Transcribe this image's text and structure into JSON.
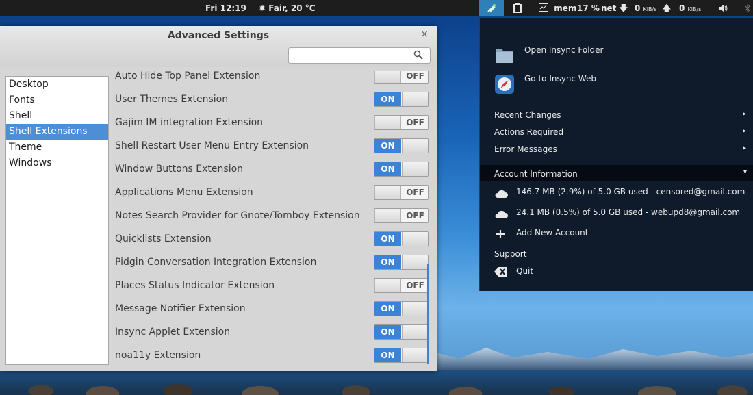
{
  "top_panel": {
    "clock": "Fri 12:19",
    "weather": "Fair, 20 °C",
    "mem_label": "mem",
    "cpu_value": "17",
    "cpu_unit": "%",
    "net_label": "net",
    "down_value": "0",
    "down_unit": "KiB/s",
    "up_value": "0",
    "up_unit": "KiB/s"
  },
  "window": {
    "title": "Advanced Settings",
    "close": "×",
    "search": {
      "value": "",
      "placeholder": ""
    }
  },
  "sidebar": {
    "items": [
      {
        "label": "Desktop",
        "selected": false
      },
      {
        "label": "Fonts",
        "selected": false
      },
      {
        "label": "Shell",
        "selected": false
      },
      {
        "label": "Shell Extensions",
        "selected": true
      },
      {
        "label": "Theme",
        "selected": false
      },
      {
        "label": "Windows",
        "selected": false
      }
    ]
  },
  "extensions": [
    {
      "label": "Auto Hide Top Panel Extension",
      "state": "OFF"
    },
    {
      "label": "User Themes Extension",
      "state": "ON"
    },
    {
      "label": "Gajim IM integration Extension",
      "state": "OFF"
    },
    {
      "label": "Shell Restart User Menu Entry Extension",
      "state": "ON"
    },
    {
      "label": "Window Buttons Extension",
      "state": "ON"
    },
    {
      "label": "Applications Menu Extension",
      "state": "OFF"
    },
    {
      "label": "Notes Search Provider for Gnote/Tomboy Extension",
      "state": "OFF"
    },
    {
      "label": "Quicklists Extension",
      "state": "ON"
    },
    {
      "label": "Pidgin Conversation Integration Extension",
      "state": "ON"
    },
    {
      "label": "Places Status Indicator Extension",
      "state": "OFF"
    },
    {
      "label": "Message Notifier Extension",
      "state": "ON"
    },
    {
      "label": "Insync Applet Extension",
      "state": "ON"
    },
    {
      "label": "noa11y Extension",
      "state": "ON"
    }
  ],
  "insync_menu": {
    "open_folder": "Open Insync Folder",
    "go_web": "Go to Insync Web",
    "recent_changes": "Recent Changes",
    "actions_required": "Actions Required",
    "error_messages": "Error Messages",
    "account_information": "Account Information",
    "account1": "146.7 MB (2.9%) of 5.0 GB used - censored@gmail.com",
    "account2": "24.1 MB (0.5%) of 5.0 GB used - webupd8@gmail.com",
    "add_account": "Add New Account",
    "support": "Support",
    "quit": "Quit",
    "submenu_arrow": "▸",
    "expand_arrow": "▾"
  },
  "colors": {
    "accent": "#3b83d6",
    "panel": "#1d1d1d",
    "menu_bg": "#0f1a2b"
  }
}
